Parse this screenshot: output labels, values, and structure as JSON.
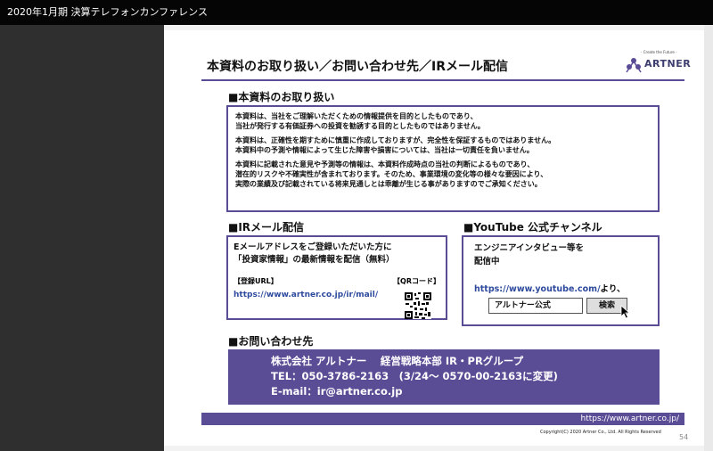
{
  "window": {
    "title": "2020年1月期 決算テレフォンカンファレンス"
  },
  "slide": {
    "title": "本資料のお取り扱い／お問い合わせ先／IRメール配信",
    "logo": {
      "tagline": "- Create the Future -",
      "name": "ARTNER",
      "accent_color": "#5b4c96"
    },
    "section1": {
      "heading": "■本資料のお取り扱い",
      "paragraphs": [
        [
          "本資料は、当社をご理解いただくための情報提供を目的としたものであり、",
          "当社が発行する有価証券への投資を勧誘する目的としたものではありません。"
        ],
        [
          "本資料は、正確性を期すために慎重に作成しておりますが、完全性を保証するものではありません。",
          "本資料中の予測や情報によって生じた障害や損害については、当社は一切責任を負いません。"
        ],
        [
          "本資料に記載された意見や予測等の情報は、本資料作成時点の当社の判断によるものであり、",
          "潜在的リスクや不確実性が含まれております。そのため、事業環境の変化等の様々な要因により、",
          "実際の業績及び記載されている将来見通しとは乖離が生じる事がありますのでご承知ください。"
        ]
      ]
    },
    "section2": {
      "heading": "■IRメール配信",
      "lines": [
        "Eメールアドレスをご登録いただいた方に",
        "「投資家情報」の最新情報を配信（無料）"
      ],
      "register_label": "【登録URL】",
      "qr_label": "【QRコード】",
      "url": "https://www.artner.co.jp/ir/mail/"
    },
    "section3": {
      "heading": "■YouTube 公式チャンネル",
      "lines": [
        "エンジニアインタビュー等を",
        "配信中"
      ],
      "url": "https://www.youtube.com/",
      "url_suffix": "より、",
      "search_value": "アルトナー公式",
      "search_button": "検索"
    },
    "section4": {
      "heading": "■お問い合わせ先",
      "company": "株式会社 アルトナー　 経営戦略本部 IR・PRグループ",
      "tel": "TEL：050-3786-2163　(3/24～ 0570-00-2163に変更)",
      "email": "E-mail：ir@artner.co.jp"
    },
    "footer": {
      "url": "https://www.artner.co.jp/",
      "copyright": "Copyright(C) 2020 Artner Co., Ltd. All Rights Reserved",
      "page_number": "54"
    }
  }
}
